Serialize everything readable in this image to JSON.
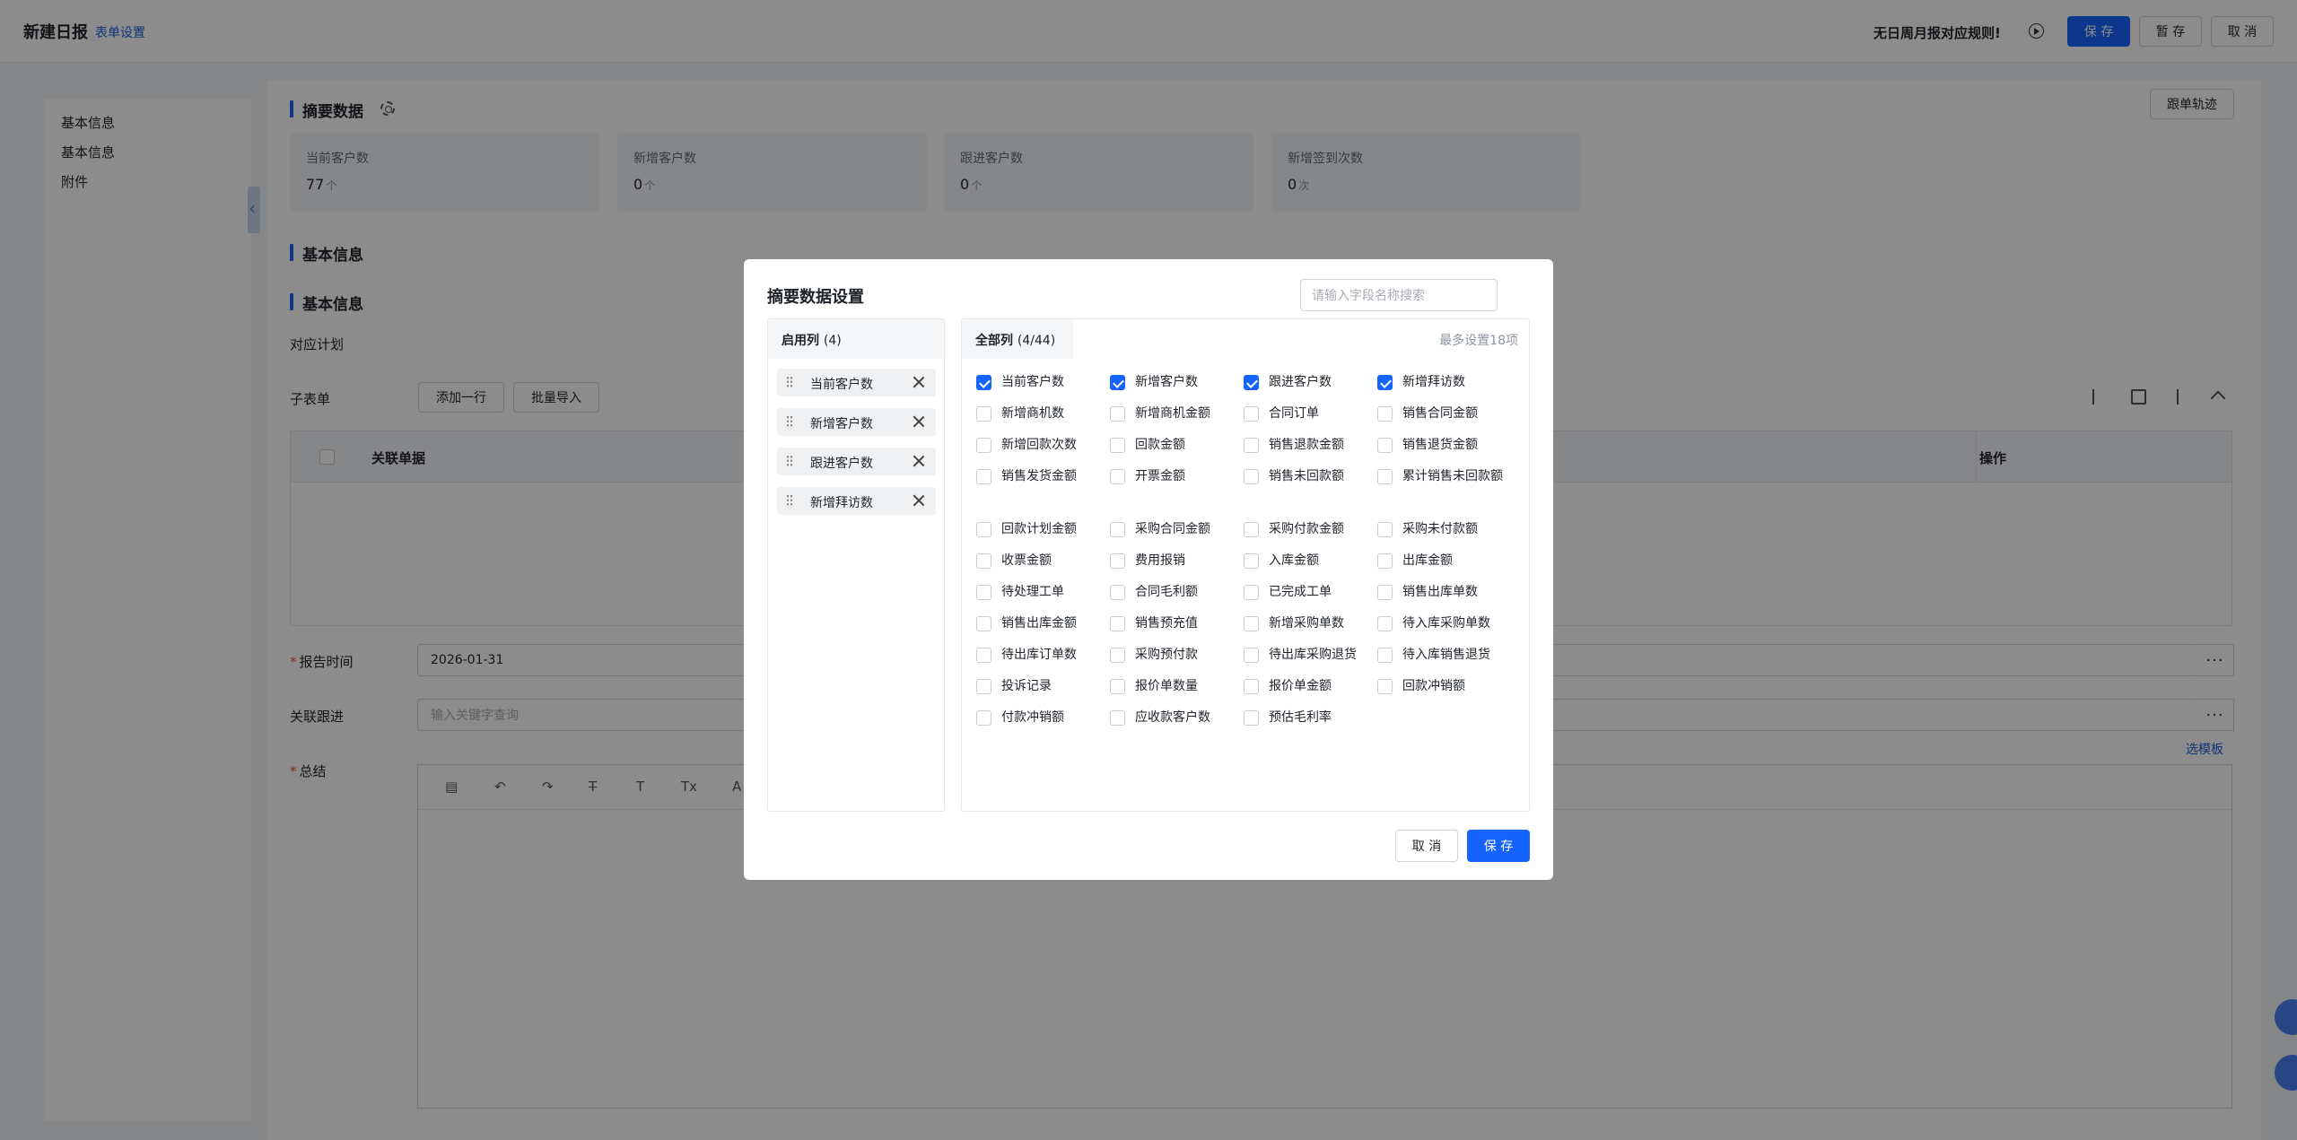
{
  "header": {
    "title": "新建日报",
    "form_setting": "表单设置",
    "rule_tip": "无日周月报对应规则!",
    "save": "保 存",
    "draft": "暂 存",
    "cancel": "取 消"
  },
  "sidebar": {
    "items": [
      "基本信息",
      "基本信息",
      "附件"
    ]
  },
  "main": {
    "summary_title": "摘要数据",
    "track_button": "跟单轨迹",
    "stats": [
      {
        "label": "当前客户数",
        "value": "77",
        "unit": "个"
      },
      {
        "label": "新增客户数",
        "value": "0",
        "unit": "个"
      },
      {
        "label": "跟进客户数",
        "value": "0",
        "unit": "个"
      },
      {
        "label": "新增签到次数",
        "value": "0",
        "unit": "次"
      }
    ],
    "basic_title_1": "基本信息",
    "basic_title_2": "基本信息",
    "plan_label": "对应计划",
    "subtable_label": "子表单",
    "add_row": "添加一行",
    "batch_import": "批量导入",
    "table_columns": {
      "related": "关联单据",
      "action": "操作"
    },
    "report_time_label": "报告时间",
    "report_time_value": "2026-01-31",
    "related_follow_label": "关联跟进",
    "related_follow_placeholder": "输入关键字查询",
    "summary_label": "总结",
    "choose_template": "选模板"
  },
  "modal": {
    "title": "摘要数据设置",
    "search_placeholder": "请输入字段名称搜索",
    "enabled_label": "启用列",
    "enabled_count": "(4)",
    "enabled": [
      "当前客户数",
      "新增客户数",
      "跟进客户数",
      "新增拜访数"
    ],
    "all_label": "全部列",
    "all_count": "(4/44)",
    "max_note": "最多设置18项",
    "options": [
      {
        "label": "当前客户数",
        "checked": true
      },
      {
        "label": "新增客户数",
        "checked": true
      },
      {
        "label": "跟进客户数",
        "checked": true
      },
      {
        "label": "新增拜访数",
        "checked": true
      },
      {
        "label": "新增商机数",
        "checked": false
      },
      {
        "label": "新增商机金额",
        "checked": false
      },
      {
        "label": "合同订单",
        "checked": false
      },
      {
        "label": "销售合同金额",
        "checked": false
      },
      {
        "label": "新增回款次数",
        "checked": false
      },
      {
        "label": "回款金额",
        "checked": false
      },
      {
        "label": "销售退款金额",
        "checked": false
      },
      {
        "label": "销售退货金额",
        "checked": false
      },
      {
        "label": "销售发货金额",
        "checked": false
      },
      {
        "label": "开票金额",
        "checked": false
      },
      {
        "label": "销售未回款额",
        "checked": false
      },
      {
        "label": "累计销售未回款额",
        "checked": false
      },
      {
        "label": "回款计划金额",
        "checked": false
      },
      {
        "label": "采购合同金额",
        "checked": false
      },
      {
        "label": "采购付款金额",
        "checked": false
      },
      {
        "label": "采购未付款额",
        "checked": false
      },
      {
        "label": "收票金额",
        "checked": false
      },
      {
        "label": "费用报销",
        "checked": false
      },
      {
        "label": "入库金额",
        "checked": false
      },
      {
        "label": "出库金额",
        "checked": false
      },
      {
        "label": "待处理工单",
        "checked": false
      },
      {
        "label": "合同毛利额",
        "checked": false
      },
      {
        "label": "已完成工单",
        "checked": false
      },
      {
        "label": "销售出库单数",
        "checked": false
      },
      {
        "label": "销售出库金额",
        "checked": false
      },
      {
        "label": "销售预充值",
        "checked": false
      },
      {
        "label": "新增采购单数",
        "checked": false
      },
      {
        "label": "待入库采购单数",
        "checked": false
      },
      {
        "label": "待出库订单数",
        "checked": false
      },
      {
        "label": "采购预付款",
        "checked": false
      },
      {
        "label": "待出库采购退货",
        "checked": false
      },
      {
        "label": "待入库销售退货",
        "checked": false
      },
      {
        "label": "投诉记录",
        "checked": false
      },
      {
        "label": "报价单数量",
        "checked": false
      },
      {
        "label": "报价单金额",
        "checked": false
      },
      {
        "label": "回款冲销额",
        "checked": false
      },
      {
        "label": "付款冲销额",
        "checked": false
      },
      {
        "label": "应收款客户数",
        "checked": false
      },
      {
        "label": "预估毛利率",
        "checked": false
      }
    ],
    "cancel": "取 消",
    "save": "保 存"
  }
}
